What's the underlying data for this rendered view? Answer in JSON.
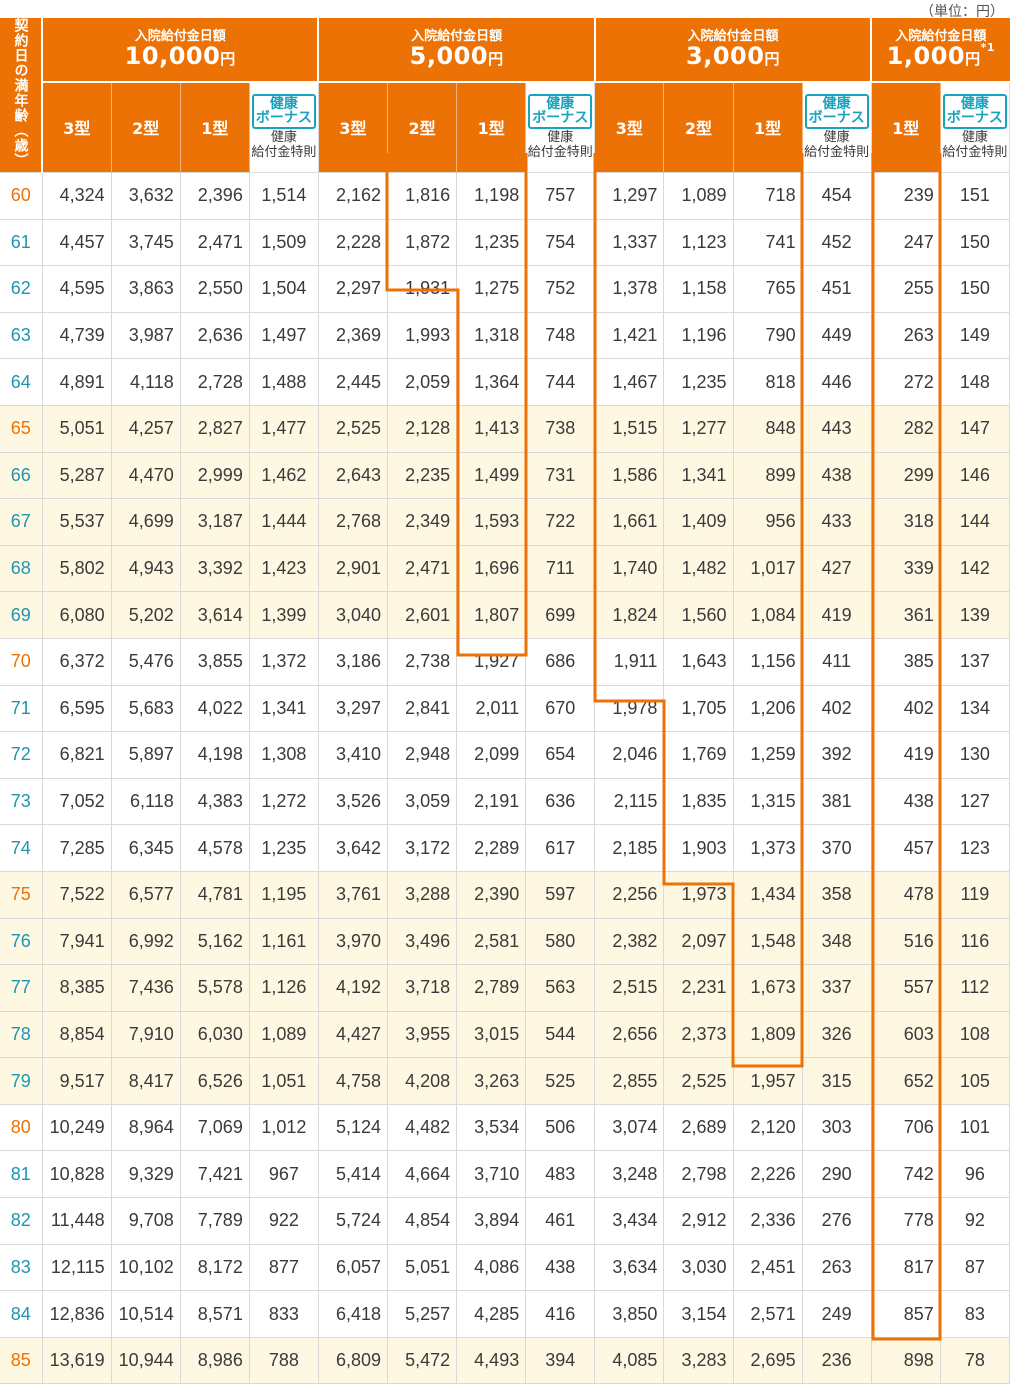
{
  "unit_note": "（単位：円）",
  "age_header": "契約日の満年齢（歳）",
  "groups": [
    {
      "label": "入院給付金日額",
      "amount": "10,000",
      "yen": "円",
      "mark": ""
    },
    {
      "label": "入院給付金日額",
      "amount": "5,000",
      "yen": "円",
      "mark": ""
    },
    {
      "label": "入院給付金日額",
      "amount": "3,000",
      "yen": "円",
      "mark": ""
    },
    {
      "label": "入院給付金日額",
      "amount": "1,000",
      "yen": "円",
      "mark": "*1"
    }
  ],
  "types": {
    "t3": "3型",
    "t2": "2型",
    "t1": "1型"
  },
  "bonus": {
    "badge": "健康ボーナス",
    "note": "健康給付金特則"
  },
  "colors": {
    "orange": "#ec7205",
    "teal": "#1f95b0",
    "highlight": "#fef8e3",
    "badge": "#1aa3bd"
  },
  "rows": [
    {
      "age": "60",
      "v": [
        "4,324",
        "3,632",
        "2,396",
        "1,514",
        "2,162",
        "1,816",
        "1,198",
        "757",
        "1,297",
        "1,089",
        "718",
        "454",
        "239",
        "151"
      ]
    },
    {
      "age": "61",
      "v": [
        "4,457",
        "3,745",
        "2,471",
        "1,509",
        "2,228",
        "1,872",
        "1,235",
        "754",
        "1,337",
        "1,123",
        "741",
        "452",
        "247",
        "150"
      ]
    },
    {
      "age": "62",
      "v": [
        "4,595",
        "3,863",
        "2,550",
        "1,504",
        "2,297",
        "1,931",
        "1,275",
        "752",
        "1,378",
        "1,158",
        "765",
        "451",
        "255",
        "150"
      ]
    },
    {
      "age": "63",
      "v": [
        "4,739",
        "3,987",
        "2,636",
        "1,497",
        "2,369",
        "1,993",
        "1,318",
        "748",
        "1,421",
        "1,196",
        "790",
        "449",
        "263",
        "149"
      ]
    },
    {
      "age": "64",
      "v": [
        "4,891",
        "4,118",
        "2,728",
        "1,488",
        "2,445",
        "2,059",
        "1,364",
        "744",
        "1,467",
        "1,235",
        "818",
        "446",
        "272",
        "148"
      ]
    },
    {
      "age": "65",
      "v": [
        "5,051",
        "4,257",
        "2,827",
        "1,477",
        "2,525",
        "2,128",
        "1,413",
        "738",
        "1,515",
        "1,277",
        "848",
        "443",
        "282",
        "147"
      ]
    },
    {
      "age": "66",
      "v": [
        "5,287",
        "4,470",
        "2,999",
        "1,462",
        "2,643",
        "2,235",
        "1,499",
        "731",
        "1,586",
        "1,341",
        "899",
        "438",
        "299",
        "146"
      ]
    },
    {
      "age": "67",
      "v": [
        "5,537",
        "4,699",
        "3,187",
        "1,444",
        "2,768",
        "2,349",
        "1,593",
        "722",
        "1,661",
        "1,409",
        "956",
        "433",
        "318",
        "144"
      ]
    },
    {
      "age": "68",
      "v": [
        "5,802",
        "4,943",
        "3,392",
        "1,423",
        "2,901",
        "2,471",
        "1,696",
        "711",
        "1,740",
        "1,482",
        "1,017",
        "427",
        "339",
        "142"
      ]
    },
    {
      "age": "69",
      "v": [
        "6,080",
        "5,202",
        "3,614",
        "1,399",
        "3,040",
        "2,601",
        "1,807",
        "699",
        "1,824",
        "1,560",
        "1,084",
        "419",
        "361",
        "139"
      ]
    },
    {
      "age": "70",
      "v": [
        "6,372",
        "5,476",
        "3,855",
        "1,372",
        "3,186",
        "2,738",
        "1,927",
        "686",
        "1,911",
        "1,643",
        "1,156",
        "411",
        "385",
        "137"
      ]
    },
    {
      "age": "71",
      "v": [
        "6,595",
        "5,683",
        "4,022",
        "1,341",
        "3,297",
        "2,841",
        "2,011",
        "670",
        "1,978",
        "1,705",
        "1,206",
        "402",
        "402",
        "134"
      ]
    },
    {
      "age": "72",
      "v": [
        "6,821",
        "5,897",
        "4,198",
        "1,308",
        "3,410",
        "2,948",
        "2,099",
        "654",
        "2,046",
        "1,769",
        "1,259",
        "392",
        "419",
        "130"
      ]
    },
    {
      "age": "73",
      "v": [
        "7,052",
        "6,118",
        "4,383",
        "1,272",
        "3,526",
        "3,059",
        "2,191",
        "636",
        "2,115",
        "1,835",
        "1,315",
        "381",
        "438",
        "127"
      ]
    },
    {
      "age": "74",
      "v": [
        "7,285",
        "6,345",
        "4,578",
        "1,235",
        "3,642",
        "3,172",
        "2,289",
        "617",
        "2,185",
        "1,903",
        "1,373",
        "370",
        "457",
        "123"
      ]
    },
    {
      "age": "75",
      "v": [
        "7,522",
        "6,577",
        "4,781",
        "1,195",
        "3,761",
        "3,288",
        "2,390",
        "597",
        "2,256",
        "1,973",
        "1,434",
        "358",
        "478",
        "119"
      ]
    },
    {
      "age": "76",
      "v": [
        "7,941",
        "6,992",
        "5,162",
        "1,161",
        "3,970",
        "3,496",
        "2,581",
        "580",
        "2,382",
        "2,097",
        "1,548",
        "348",
        "516",
        "116"
      ]
    },
    {
      "age": "77",
      "v": [
        "8,385",
        "7,436",
        "5,578",
        "1,126",
        "4,192",
        "3,718",
        "2,789",
        "563",
        "2,515",
        "2,231",
        "1,673",
        "337",
        "557",
        "112"
      ]
    },
    {
      "age": "78",
      "v": [
        "8,854",
        "7,910",
        "6,030",
        "1,089",
        "4,427",
        "3,955",
        "3,015",
        "544",
        "2,656",
        "2,373",
        "1,809",
        "326",
        "603",
        "108"
      ]
    },
    {
      "age": "79",
      "v": [
        "9,517",
        "8,417",
        "6,526",
        "1,051",
        "4,758",
        "4,208",
        "3,263",
        "525",
        "2,855",
        "2,525",
        "1,957",
        "315",
        "652",
        "105"
      ]
    },
    {
      "age": "80",
      "v": [
        "10,249",
        "8,964",
        "7,069",
        "1,012",
        "5,124",
        "4,482",
        "3,534",
        "506",
        "3,074",
        "2,689",
        "2,120",
        "303",
        "706",
        "101"
      ]
    },
    {
      "age": "81",
      "v": [
        "10,828",
        "9,329",
        "7,421",
        "967",
        "5,414",
        "4,664",
        "3,710",
        "483",
        "3,248",
        "2,798",
        "2,226",
        "290",
        "742",
        "96"
      ]
    },
    {
      "age": "82",
      "v": [
        "11,448",
        "9,708",
        "7,789",
        "922",
        "5,724",
        "4,854",
        "3,894",
        "461",
        "3,434",
        "2,912",
        "2,336",
        "276",
        "778",
        "92"
      ]
    },
    {
      "age": "83",
      "v": [
        "12,115",
        "10,102",
        "8,172",
        "877",
        "6,057",
        "5,051",
        "4,086",
        "438",
        "3,634",
        "3,030",
        "2,451",
        "263",
        "817",
        "87"
      ]
    },
    {
      "age": "84",
      "v": [
        "12,836",
        "10,514",
        "8,571",
        "833",
        "6,418",
        "5,257",
        "4,285",
        "416",
        "3,850",
        "3,154",
        "2,571",
        "249",
        "857",
        "83"
      ]
    },
    {
      "age": "85",
      "v": [
        "13,619",
        "10,944",
        "8,986",
        "788",
        "6,809",
        "5,472",
        "4,493",
        "394",
        "4,085",
        "3,283",
        "2,695",
        "236",
        "898",
        "78"
      ]
    }
  ]
}
